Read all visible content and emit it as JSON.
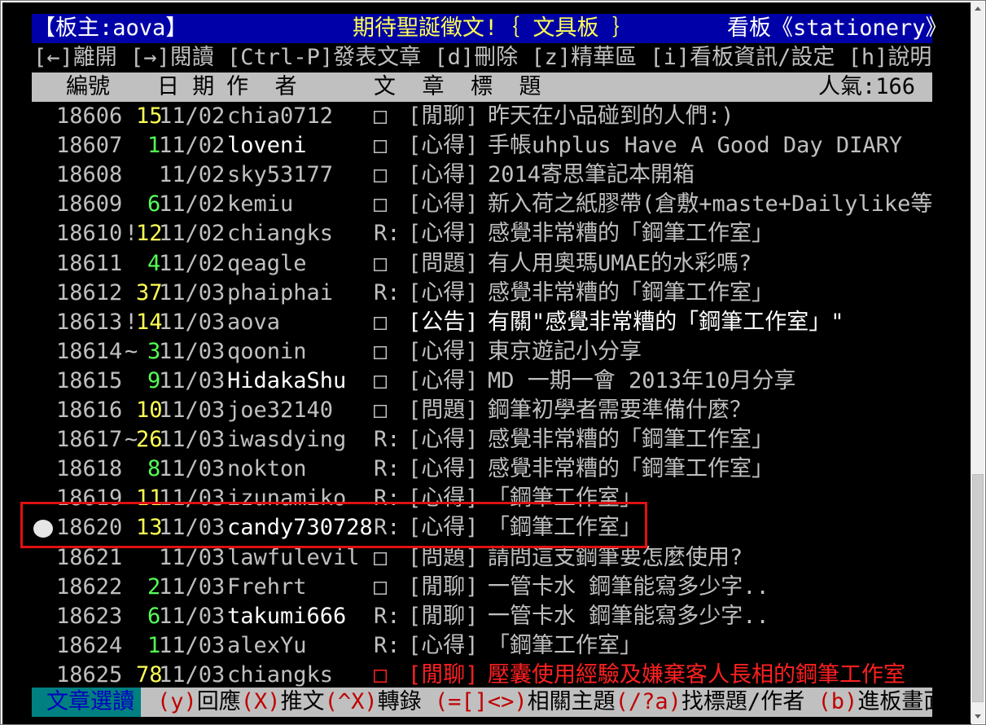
{
  "title_bar": {
    "moderator": "【板主:aova】",
    "notice": "期待聖誕徵文!｛ 文具板 ｝",
    "board": "看板《stationery》"
  },
  "menu_bar": "[←]離開 [→]閱讀 [Ctrl-P]發表文章 [d]刪除 [z]精華區 [i]看板資訊/設定 [h]說明",
  "header": {
    "number": "編號",
    "date": "日 期",
    "author": "作  者",
    "title": "文  章  標  題",
    "popularity": "人氣:166"
  },
  "posts": [
    {
      "no": "18606",
      "mark": "",
      "recommend": "15",
      "date": "11/02",
      "author": "chia0712",
      "type": "□",
      "category": "[閒聊]",
      "title": "昨天在小品碰到的人們:)"
    },
    {
      "no": "18607",
      "mark": "",
      "recommend": "1",
      "date": "11/02",
      "author": "loveni",
      "type": "□",
      "category": "[心得]",
      "title": "手帳uhplus Have A Good Day DIARY"
    },
    {
      "no": "18608",
      "mark": "",
      "recommend": "",
      "date": "11/02",
      "author": "sky53177",
      "type": "□",
      "category": "[心得]",
      "title": "2014寄思筆記本開箱"
    },
    {
      "no": "18609",
      "mark": "",
      "recommend": "6",
      "date": "11/02",
      "author": "kemiu",
      "type": "□",
      "category": "[心得]",
      "title": "新入荷之紙膠帶(倉敷+maste+Dailylike等"
    },
    {
      "no": "18610",
      "mark": "!",
      "recommend": "12",
      "date": "11/02",
      "author": "chiangks",
      "type": "R:",
      "category": "[心得]",
      "title": "感覺非常糟的「鋼筆工作室」"
    },
    {
      "no": "18611",
      "mark": "",
      "recommend": "4",
      "date": "11/02",
      "author": "qeagle",
      "type": "□",
      "category": "[問題]",
      "title": "有人用奧瑪UMAE的水彩嗎?"
    },
    {
      "no": "18612",
      "mark": "",
      "recommend": "37",
      "date": "11/03",
      "author": "phaiphai",
      "type": "R:",
      "category": "[心得]",
      "title": "感覺非常糟的「鋼筆工作室」"
    },
    {
      "no": "18613",
      "mark": "!",
      "recommend": "14",
      "date": "11/03",
      "author": "aova",
      "type": "□",
      "category": "[公告]",
      "title": "有關\"感覺非常糟的「鋼筆工作室」\""
    },
    {
      "no": "18614",
      "mark": "~",
      "recommend": "3",
      "date": "11/03",
      "author": "qoonin",
      "type": "□",
      "category": "[心得]",
      "title": "東京遊記小分享"
    },
    {
      "no": "18615",
      "mark": "",
      "recommend": "9",
      "date": "11/03",
      "author": "HidakaShu",
      "type": "□",
      "category": "[心得]",
      "title": "MD 一期一會 2013年10月分享"
    },
    {
      "no": "18616",
      "mark": "",
      "recommend": "10",
      "date": "11/03",
      "author": "joe32140",
      "type": "□",
      "category": "[問題]",
      "title": "鋼筆初學者需要準備什麼？"
    },
    {
      "no": "18617",
      "mark": "~",
      "recommend": "26",
      "date": "11/03",
      "author": "iwasdying",
      "type": "R:",
      "category": "[心得]",
      "title": "感覺非常糟的「鋼筆工作室」"
    },
    {
      "no": "18618",
      "mark": "",
      "recommend": "8",
      "date": "11/03",
      "author": "nokton",
      "type": "R:",
      "category": "[心得]",
      "title": "感覺非常糟的「鋼筆工作室」"
    },
    {
      "no": "18619",
      "mark": "",
      "recommend": "11",
      "date": "11/03",
      "author": "izunamiko",
      "type": "R:",
      "category": "[心得]",
      "title": "「鋼筆工作室」"
    },
    {
      "no": "18620",
      "mark": "",
      "recommend": "13",
      "date": "11/03",
      "author": "candy730728",
      "type": "R:",
      "category": "[心得]",
      "title": "「鋼筆工作室」"
    },
    {
      "no": "18621",
      "mark": "",
      "recommend": "",
      "date": "11/03",
      "author": "lawfulevil",
      "type": "□",
      "category": "[問題]",
      "title": "請問這支鋼筆要怎麼使用?"
    },
    {
      "no": "18622",
      "mark": "",
      "recommend": "2",
      "date": "11/03",
      "author": "Frehrt",
      "type": "□",
      "category": "[閒聊]",
      "title": "一管卡水 鋼筆能寫多少字.."
    },
    {
      "no": "18623",
      "mark": "",
      "recommend": "6",
      "date": "11/03",
      "author": "takumi666",
      "type": "R:",
      "category": "[閒聊]",
      "title": "一管卡水 鋼筆能寫多少字.."
    },
    {
      "no": "18624",
      "mark": "",
      "recommend": "1",
      "date": "11/03",
      "author": "alexYu",
      "type": "R:",
      "category": "[心得]",
      "title": "「鋼筆工作室」"
    },
    {
      "no": "18625",
      "mark": "",
      "recommend": "78",
      "date": "11/03",
      "author": "chiangks",
      "type": "□",
      "category": "[閒聊]",
      "title": "壓囊使用經驗及嫌棄客人長相的鋼筆工作室"
    }
  ],
  "footer": {
    "mode": "文章選讀",
    "help": [
      {
        "key": "(y)",
        "text": "回應"
      },
      {
        "key": "(X)",
        "text": "推文"
      },
      {
        "key": "(^X)",
        "text": "轉錄 "
      },
      {
        "key": "(=[]<>)",
        "text": "相關主題"
      },
      {
        "key": "(/?a)",
        "text": "找標題/作者 "
      },
      {
        "key": "(b)",
        "text": "進板畫面"
      }
    ]
  },
  "colors": {
    "background": "#000000",
    "title_bar": "#0000a8",
    "header_bar": "#c0c0c0",
    "recommend_yellow": "#ffff55",
    "recommend_green": "#55ff55",
    "highlight_red": "#ff2020",
    "annotation_box": "#e01010",
    "footer_mode_bg": "#008080"
  }
}
